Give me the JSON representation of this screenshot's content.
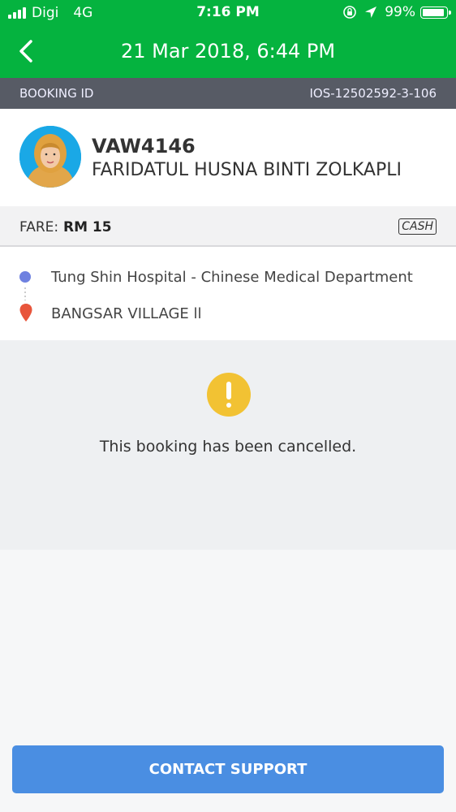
{
  "status_bar": {
    "carrier": "Digi",
    "network": "4G",
    "time": "7:16 PM",
    "battery_percent": "99%",
    "battery_level": 0.99,
    "icons": [
      "signal-icon",
      "rotation-lock-icon",
      "location-arrow-icon",
      "battery-icon"
    ]
  },
  "header": {
    "title": "21 Mar 2018, 6:44 PM",
    "back_icon": "chevron-left-icon"
  },
  "booking": {
    "label": "BOOKING ID",
    "id": "IOS-12502592-3-106"
  },
  "driver": {
    "plate": "VAW4146",
    "name": "FARIDATUL HUSNA BINTI ZOLKAPLI"
  },
  "fare": {
    "label": "FARE:",
    "amount": "RM 15",
    "payment_method": "CASH"
  },
  "route": {
    "pickup": "Tung Shin Hospital - Chinese Medical Department",
    "dropoff": "BANGSAR VILLAGE ll"
  },
  "notice": {
    "message": "This booking has been cancelled."
  },
  "actions": {
    "support_label": "CONTACT SUPPORT"
  },
  "colors": {
    "header_green": "#05b33f",
    "booking_bar": "#575b65",
    "pickup_dot": "#6f81e0",
    "dropoff_pin": "#e8553b",
    "warning": "#f2c233",
    "button_blue": "#4a8ee2"
  }
}
